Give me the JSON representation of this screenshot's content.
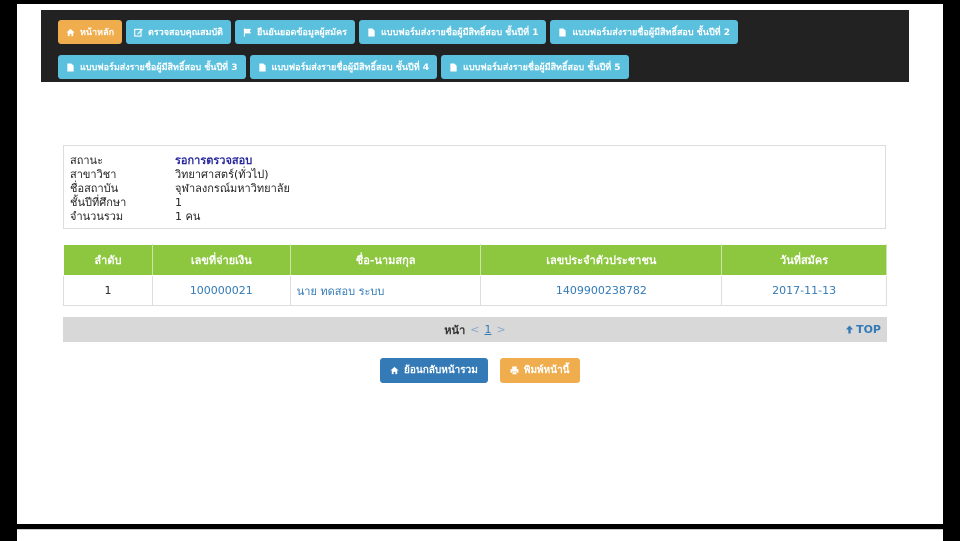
{
  "nav": {
    "row1": [
      {
        "label": "หน้าหลัก",
        "icon": "home-icon",
        "active": true
      },
      {
        "label": "ตรวจสอบคุณสมบัติ",
        "icon": "edit-icon",
        "active": false
      },
      {
        "label": "ยืนยันยอดข้อมูลผู้สมัคร",
        "icon": "flag-icon",
        "active": false
      },
      {
        "label": "แบบฟอร์มส่งรายชื่อผู้มีสิทธิ์สอบ ชั้นปีที่ 1",
        "icon": "file-icon",
        "active": false
      },
      {
        "label": "แบบฟอร์มส่งรายชื่อผู้มีสิทธิ์สอบ ชั้นปีที่ 2",
        "icon": "file-icon",
        "active": false
      }
    ],
    "row2": [
      {
        "label": "แบบฟอร์มส่งรายชื่อผู้มีสิทธิ์สอบ ชั้นปีที่ 3",
        "icon": "file-icon",
        "active": false
      },
      {
        "label": "แบบฟอร์มส่งรายชื่อผู้มีสิทธิ์สอบ ชั้นปีที่ 4",
        "icon": "file-icon",
        "active": false
      },
      {
        "label": "แบบฟอร์มส่งรายชื่อผู้มีสิทธิ์สอบ ชั้นปีที่ 5",
        "icon": "file-icon",
        "active": false
      }
    ]
  },
  "info": {
    "status_label": "สถานะ",
    "status_value": "รอการตรวจสอบ",
    "subject_label": "สาขาวิชา",
    "subject_value": "วิทยาศาสตร์(ทั่วไป)",
    "institution_label": "ชื่อสถาบัน",
    "institution_value": "จุฬาลงกรณ์มหาวิทยาลัย",
    "year_label": "ชั้นปีที่ศึกษา",
    "year_value": "1",
    "total_label": "จำนวนรวม",
    "total_value": "1  คน"
  },
  "table": {
    "headers": [
      "ลำดับ",
      "เลขที่จ่ายเงิน",
      "ชื่อ-นามสกุล",
      "เลขประจำตัวประชาชน",
      "วันที่สมัคร"
    ],
    "rows": [
      [
        "1",
        "100000021",
        "นาย ทดสอบ ระบบ",
        "1409900238782",
        "2017-11-13"
      ]
    ]
  },
  "pager": {
    "label": "หน้า",
    "prev": "<",
    "page": "1",
    "next": ">",
    "top_label": "TOP"
  },
  "actions": {
    "back_label": "ย้อนกลับหน้ารวม",
    "print_label": "พิมพ์หน้านี้"
  },
  "colors": {
    "nav_bg": "#222222",
    "nav_btn": "#5bc0de",
    "nav_active": "#f0ad4e",
    "table_header": "#8dc63f",
    "link": "#337ab7"
  }
}
